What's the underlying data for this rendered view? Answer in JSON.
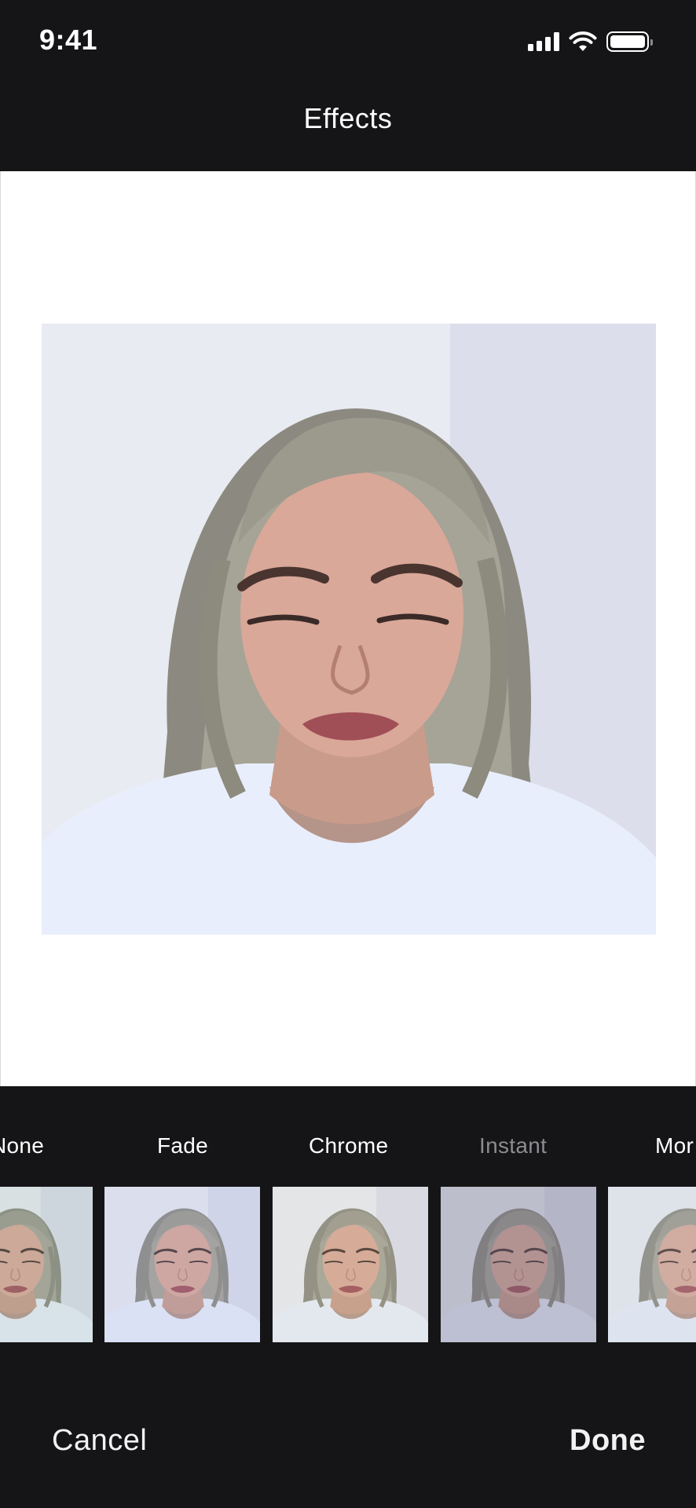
{
  "status_bar": {
    "time": "9:41",
    "icons": [
      "cellular-signal-icon",
      "wifi-icon",
      "battery-icon"
    ]
  },
  "nav": {
    "title": "Effects"
  },
  "filters": [
    {
      "label": "None",
      "selected": false
    },
    {
      "label": "Fade",
      "selected": false
    },
    {
      "label": "Chrome",
      "selected": false
    },
    {
      "label": "Instant",
      "selected": true
    },
    {
      "label": "Mono",
      "visible_text": "Mor",
      "selected": false
    }
  ],
  "toolbar": {
    "cancel_label": "Cancel",
    "done_label": "Done"
  },
  "colors": {
    "background": "#151517",
    "canvas": "#ffffff",
    "text": "#ffffff",
    "selected_filter_text": "#8c8c90"
  }
}
